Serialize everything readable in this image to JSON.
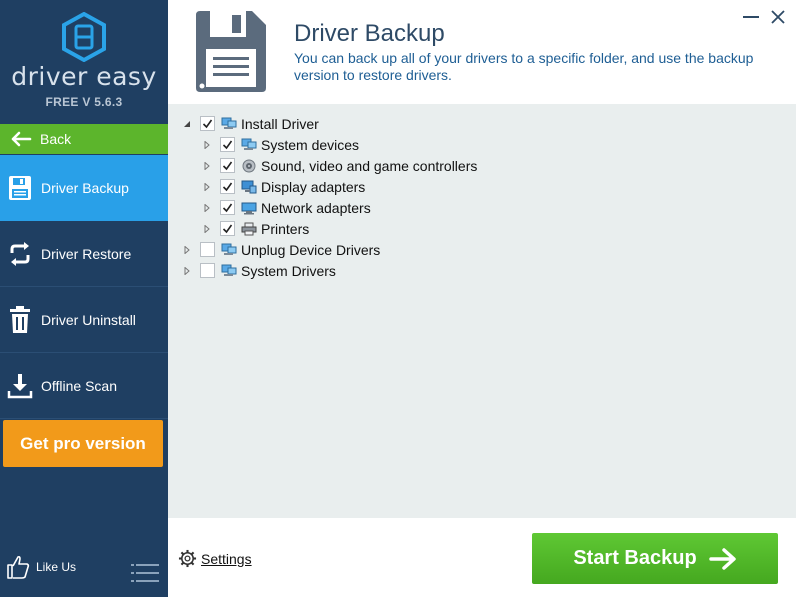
{
  "app": {
    "logo_text": "driver easy",
    "version": "FREE V 5.6.3"
  },
  "sidebar": {
    "back_label": "Back",
    "items": [
      {
        "label": "Driver Backup",
        "icon": "floppy-disk-icon",
        "active": true
      },
      {
        "label": "Driver Restore",
        "icon": "restore-arrows-icon",
        "active": false
      },
      {
        "label": "Driver Uninstall",
        "icon": "trash-icon",
        "active": false
      },
      {
        "label": "Offline Scan",
        "icon": "download-icon",
        "active": false
      }
    ],
    "pro_label": "Get pro version",
    "like_label": "Like Us"
  },
  "header": {
    "title": "Driver Backup",
    "subtitle": "You can back up all of your drivers to a specific folder, and use the backup version to restore drivers."
  },
  "tree": {
    "nodes": [
      {
        "label": "Install Driver",
        "checked": true,
        "expanded": true,
        "level": 0,
        "icon": "computer-icon"
      },
      {
        "label": "System devices",
        "checked": true,
        "expanded": false,
        "level": 1,
        "icon": "computer-icon"
      },
      {
        "label": "Sound, video and game controllers",
        "checked": true,
        "expanded": false,
        "level": 1,
        "icon": "speaker-icon"
      },
      {
        "label": "Display adapters",
        "checked": true,
        "expanded": false,
        "level": 1,
        "icon": "display-icon"
      },
      {
        "label": "Network adapters",
        "checked": true,
        "expanded": false,
        "level": 1,
        "icon": "network-icon"
      },
      {
        "label": "Printers",
        "checked": true,
        "expanded": false,
        "level": 1,
        "icon": "printer-icon"
      },
      {
        "label": "Unplug Device Drivers",
        "checked": false,
        "expanded": false,
        "level": 0,
        "icon": "computer-icon"
      },
      {
        "label": "System Drivers",
        "checked": false,
        "expanded": false,
        "level": 0,
        "icon": "computer-icon"
      }
    ]
  },
  "footer": {
    "settings_label": "Settings",
    "start_label": "Start Backup"
  },
  "colors": {
    "sidebar_bg": "#1f3f62",
    "active_blue": "#29a0e8",
    "back_green": "#5cb52c",
    "pro_orange": "#f29a1a",
    "start_green": "#52b828",
    "tree_bg": "#e9eeee"
  }
}
